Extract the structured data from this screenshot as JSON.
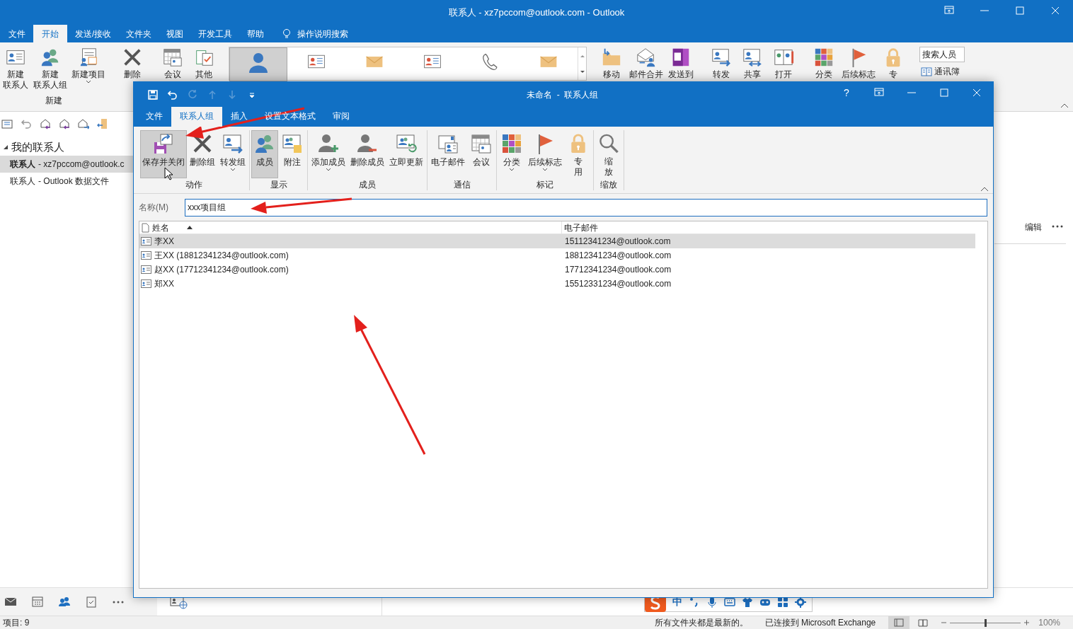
{
  "window": {
    "title": "联系人 - xz7pccom@outlook.com  -  Outlook"
  },
  "menu_tabs": [
    {
      "label": "文件",
      "selected": false
    },
    {
      "label": "开始",
      "selected": true
    },
    {
      "label": "发送/接收",
      "selected": false
    },
    {
      "label": "文件夹",
      "selected": false
    },
    {
      "label": "视图",
      "selected": false
    },
    {
      "label": "开发工具",
      "selected": false
    },
    {
      "label": "帮助",
      "selected": false
    }
  ],
  "tell_me": "操作说明搜索",
  "ribbon": {
    "groups": [
      {
        "label": "新建",
        "items": [
          {
            "lines": [
              "新建",
              "联系人"
            ],
            "dropdown": false
          },
          {
            "lines": [
              "新建",
              "联系人组"
            ],
            "dropdown": false
          },
          {
            "lines": [
              "新建项目"
            ],
            "dropdown": true
          }
        ]
      },
      {
        "items": [
          {
            "lines": [
              "删除"
            ],
            "dropdown": false
          }
        ]
      },
      {
        "items": [
          {
            "lines": [
              "会议"
            ],
            "dropdown": false
          },
          {
            "lines": [
              "其他"
            ],
            "dropdown": false
          }
        ]
      },
      {
        "items": [
          {
            "lines": [
              "移动"
            ],
            "dropdown": false
          },
          {
            "lines": [
              "邮件合并"
            ],
            "dropdown": false
          },
          {
            "lines": [
              "发送到"
            ],
            "dropdown": false
          }
        ]
      },
      {
        "items": [
          {
            "lines": [
              "转发"
            ],
            "dropdown": false
          },
          {
            "lines": [
              "共享"
            ],
            "dropdown": false
          },
          {
            "lines": [
              "打开"
            ],
            "dropdown": false
          }
        ]
      },
      {
        "items": [
          {
            "lines": [
              "分类"
            ],
            "dropdown": false
          },
          {
            "lines": [
              "后续标志"
            ],
            "dropdown": false
          },
          {
            "lines": [
              "专"
            ],
            "dropdown": false
          }
        ]
      }
    ],
    "search_people": "搜索人员",
    "address_book": "通讯簿"
  },
  "folders": [
    {
      "label": "我的联系人",
      "expanded": true,
      "children": [
        {
          "name": "**联系人**",
          "detail": "- xz7pccom@outlook.c",
          "selected": true
        },
        {
          "name": "联系人",
          "detail": "- Outlook 数据文件",
          "selected": false
        }
      ]
    }
  ],
  "reading_pane": {
    "edit": "编辑"
  },
  "nav": [
    {
      "selected": false
    },
    {
      "selected": false
    },
    {
      "selected": true
    },
    {
      "selected": false
    },
    {
      "selected": false
    }
  ],
  "ime": {
    "mode": "中"
  },
  "status_bar": {
    "items": "项目: 9",
    "sync": "所有文件夹都是最新的。",
    "connection": "已连接到 Microsoft Exchange",
    "zoom": {
      "level": 0.5,
      "reading": "100%"
    }
  },
  "dialog": {
    "title": "未命名  -  联系人组",
    "help": "?",
    "tabs": [
      {
        "label": "文件",
        "selected": false
      },
      {
        "label": "联系人组",
        "selected": true
      },
      {
        "label": "插入",
        "selected": false
      },
      {
        "label": "设置文本格式",
        "selected": false
      },
      {
        "label": "审阅",
        "selected": false
      }
    ],
    "groups": [
      {
        "label": "动作",
        "buttons": [
          {
            "lines": [
              "保存并关闭"
            ],
            "selected": true,
            "dropdown": false
          },
          {
            "lines": [
              "删除组"
            ],
            "selected": false,
            "dropdown": false
          },
          {
            "lines": [
              "转发组"
            ],
            "selected": false,
            "dropdown": true
          }
        ]
      },
      {
        "label": "显示",
        "buttons": [
          {
            "lines": [
              "成员"
            ],
            "selected": true,
            "dropdown": false
          },
          {
            "lines": [
              "附注"
            ],
            "selected": false,
            "dropdown": false
          }
        ]
      },
      {
        "label": "成员",
        "buttons": [
          {
            "lines": [
              "添加成员"
            ],
            "selected": false,
            "dropdown": true
          },
          {
            "lines": [
              "删除成员"
            ],
            "selected": false,
            "dropdown": false
          },
          {
            "lines": [
              "立即更新"
            ],
            "selected": false,
            "dropdown": false
          }
        ]
      },
      {
        "label": "通信",
        "buttons": [
          {
            "lines": [
              "电子邮件"
            ],
            "selected": false,
            "dropdown": false
          },
          {
            "lines": [
              "会议"
            ],
            "selected": false,
            "dropdown": false
          }
        ]
      },
      {
        "label": "标记",
        "buttons": [
          {
            "lines": [
              "分类"
            ],
            "selected": false,
            "dropdown": true
          },
          {
            "lines": [
              "后续标志"
            ],
            "selected": false,
            "dropdown": true
          },
          {
            "lines": [
              "专",
              "用"
            ],
            "selected": false,
            "dropdown": false
          }
        ]
      },
      {
        "label": "缩放",
        "buttons": [
          {
            "lines": [
              "缩",
              "放"
            ],
            "selected": false,
            "dropdown": false
          }
        ]
      }
    ],
    "name_label": "名称(M)",
    "name_value": "xxx项目组",
    "columns": [
      "姓名",
      "电子邮件"
    ],
    "members": [
      {
        "name": "李XX",
        "email": "15112341234@outlook.com",
        "selected": true
      },
      {
        "name": "王XX (18812341234@outlook.com)",
        "email": "18812341234@outlook.com",
        "selected": false
      },
      {
        "name": "赵XX (17712341234@outlook.com)",
        "email": "17712341234@outlook.com",
        "selected": false
      },
      {
        "name": "郑XX",
        "email": "15512331234@outlook.com",
        "selected": false
      }
    ]
  }
}
